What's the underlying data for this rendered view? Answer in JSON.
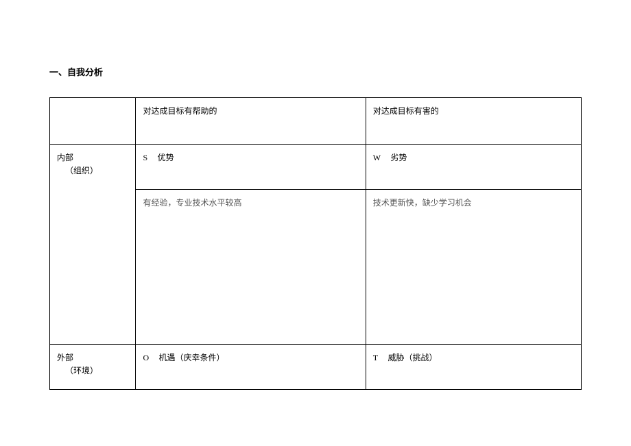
{
  "heading": "一、自我分析",
  "headers": {
    "helpful": "对达成目标有帮助的",
    "harmful": "对达成目标有害的"
  },
  "internal": {
    "label_line1": "内部",
    "label_line2": "（组织）",
    "s_letter": "S",
    "s_label": "优势",
    "w_letter": "W",
    "w_label": "劣势",
    "s_content": "有经验，专业技术水平较高",
    "w_content": "技术更新快，缺少学习机会"
  },
  "external": {
    "label_line1": "外部",
    "label_line2": "（环境）",
    "o_letter": "O",
    "o_label": "机遇（庆幸条件）",
    "t_letter": "T",
    "t_label": "威胁（挑战）"
  }
}
